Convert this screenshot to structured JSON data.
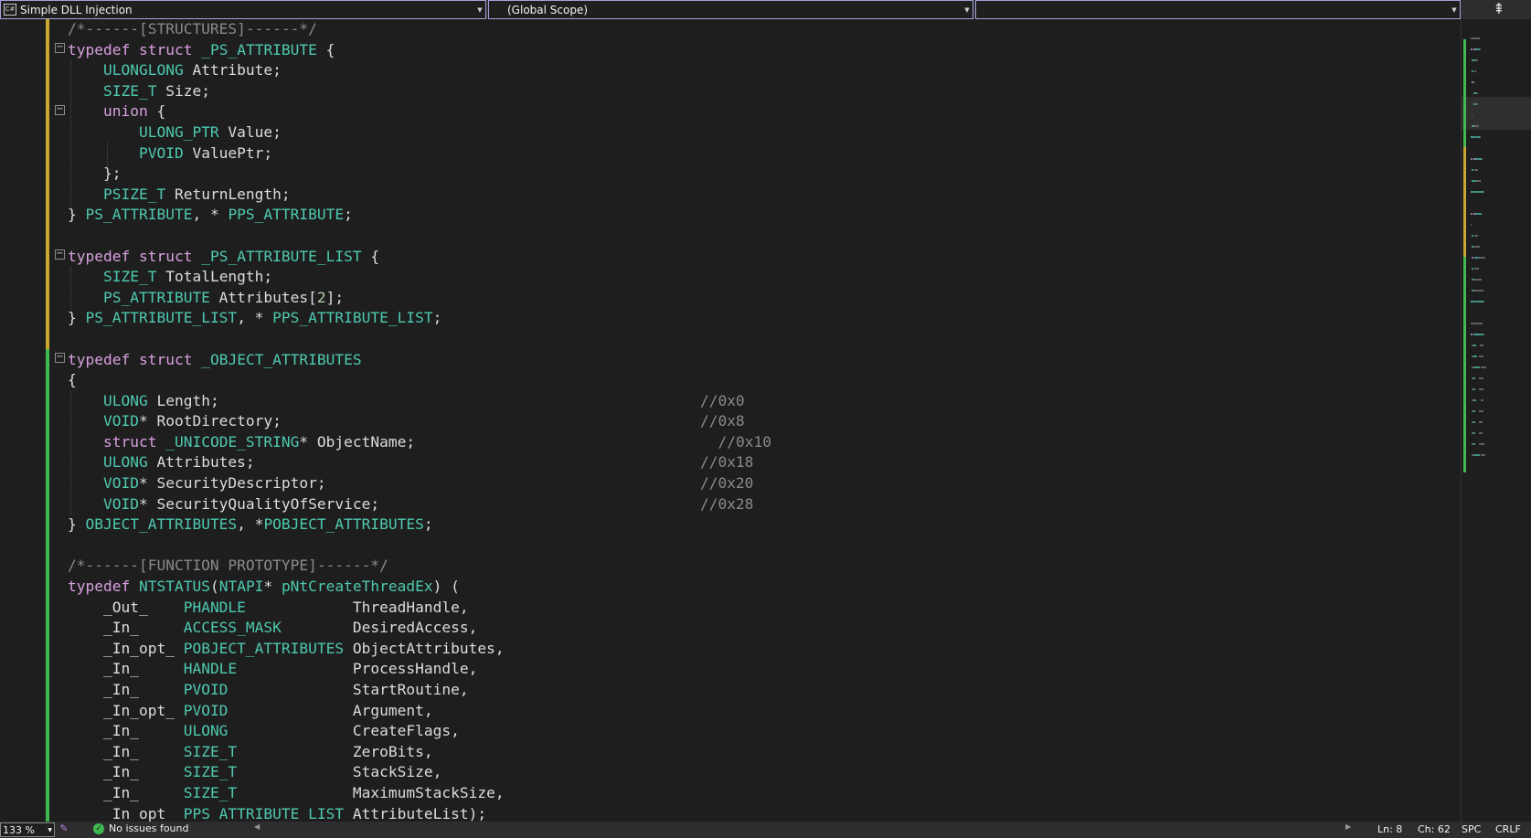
{
  "navbar": {
    "project": "Simple DLL Injection",
    "scope": "(Global Scope)",
    "member": "",
    "split_icon": "split-icon"
  },
  "code": {
    "lines": [
      [
        {
          "t": "/*------[STRUCTURES]------*/",
          "c": "cm2"
        }
      ],
      [
        {
          "t": "typedef",
          "c": "kw"
        },
        {
          "t": " ",
          "c": "pn"
        },
        {
          "t": "struct",
          "c": "kw"
        },
        {
          "t": " ",
          "c": "pn"
        },
        {
          "t": "_PS_ATTRIBUTE",
          "c": "ty"
        },
        {
          "t": " {",
          "c": "pn"
        }
      ],
      [
        {
          "t": "    ",
          "c": "pn"
        },
        {
          "t": "ULONGLONG",
          "c": "ty"
        },
        {
          "t": " Attribute;",
          "c": "id"
        }
      ],
      [
        {
          "t": "    ",
          "c": "pn"
        },
        {
          "t": "SIZE_T",
          "c": "ty"
        },
        {
          "t": " Size;",
          "c": "id"
        }
      ],
      [
        {
          "t": "    ",
          "c": "pn"
        },
        {
          "t": "union",
          "c": "kw"
        },
        {
          "t": " {",
          "c": "pn"
        }
      ],
      [
        {
          "t": "        ",
          "c": "pn"
        },
        {
          "t": "ULONG_PTR",
          "c": "ty"
        },
        {
          "t": " Value;",
          "c": "id"
        }
      ],
      [
        {
          "t": "        ",
          "c": "pn"
        },
        {
          "t": "PVOID",
          "c": "ty"
        },
        {
          "t": " ValuePtr;",
          "c": "id"
        }
      ],
      [
        {
          "t": "    };",
          "c": "pn"
        }
      ],
      [
        {
          "t": "    ",
          "c": "pn"
        },
        {
          "t": "PSIZE_T",
          "c": "ty"
        },
        {
          "t": " ReturnLength;",
          "c": "id"
        }
      ],
      [
        {
          "t": "} ",
          "c": "pn"
        },
        {
          "t": "PS_ATTRIBUTE",
          "c": "ty"
        },
        {
          "t": ", * ",
          "c": "pn"
        },
        {
          "t": "PPS_ATTRIBUTE",
          "c": "ty"
        },
        {
          "t": ";",
          "c": "pn"
        }
      ],
      [
        {
          "t": "",
          "c": "pn"
        }
      ],
      [
        {
          "t": "typedef",
          "c": "kw"
        },
        {
          "t": " ",
          "c": "pn"
        },
        {
          "t": "struct",
          "c": "kw"
        },
        {
          "t": " ",
          "c": "pn"
        },
        {
          "t": "_PS_ATTRIBUTE_LIST",
          "c": "ty"
        },
        {
          "t": " {",
          "c": "pn"
        }
      ],
      [
        {
          "t": "    ",
          "c": "pn"
        },
        {
          "t": "SIZE_T",
          "c": "ty"
        },
        {
          "t": " TotalLength;",
          "c": "id"
        }
      ],
      [
        {
          "t": "    ",
          "c": "pn"
        },
        {
          "t": "PS_ATTRIBUTE",
          "c": "ty"
        },
        {
          "t": " Attributes[",
          "c": "id"
        },
        {
          "t": "2",
          "c": "num"
        },
        {
          "t": "];",
          "c": "id"
        }
      ],
      [
        {
          "t": "} ",
          "c": "pn"
        },
        {
          "t": "PS_ATTRIBUTE_LIST",
          "c": "ty"
        },
        {
          "t": ", * ",
          "c": "pn"
        },
        {
          "t": "PPS_ATTRIBUTE_LIST",
          "c": "ty"
        },
        {
          "t": ";",
          "c": "pn"
        }
      ],
      [
        {
          "t": "",
          "c": "pn"
        }
      ],
      [
        {
          "t": "typedef",
          "c": "kw"
        },
        {
          "t": " ",
          "c": "pn"
        },
        {
          "t": "struct",
          "c": "kw"
        },
        {
          "t": " ",
          "c": "pn"
        },
        {
          "t": "_OBJECT_ATTRIBUTES",
          "c": "ty"
        }
      ],
      [
        {
          "t": "{",
          "c": "pn"
        }
      ],
      [
        {
          "t": "    ",
          "c": "pn"
        },
        {
          "t": "ULONG",
          "c": "ty"
        },
        {
          "t": " Length;                                                      ",
          "c": "id"
        },
        {
          "t": "//0x0",
          "c": "cm2"
        }
      ],
      [
        {
          "t": "    ",
          "c": "pn"
        },
        {
          "t": "VOID",
          "c": "ty"
        },
        {
          "t": "* RootDirectory;                                               ",
          "c": "id"
        },
        {
          "t": "//0x8",
          "c": "cm2"
        }
      ],
      [
        {
          "t": "    ",
          "c": "pn"
        },
        {
          "t": "struct",
          "c": "kw"
        },
        {
          "t": " ",
          "c": "pn"
        },
        {
          "t": "_UNICODE_STRING",
          "c": "ty"
        },
        {
          "t": "* ObjectName;                                  ",
          "c": "id"
        },
        {
          "t": "//0x10",
          "c": "cm2"
        }
      ],
      [
        {
          "t": "    ",
          "c": "pn"
        },
        {
          "t": "ULONG",
          "c": "ty"
        },
        {
          "t": " Attributes;                                                  ",
          "c": "id"
        },
        {
          "t": "//0x18",
          "c": "cm2"
        }
      ],
      [
        {
          "t": "    ",
          "c": "pn"
        },
        {
          "t": "VOID",
          "c": "ty"
        },
        {
          "t": "* SecurityDescriptor;                                          ",
          "c": "id"
        },
        {
          "t": "//0x20",
          "c": "cm2"
        }
      ],
      [
        {
          "t": "    ",
          "c": "pn"
        },
        {
          "t": "VOID",
          "c": "ty"
        },
        {
          "t": "* SecurityQualityOfService;                                    ",
          "c": "id"
        },
        {
          "t": "//0x28",
          "c": "cm2"
        }
      ],
      [
        {
          "t": "} ",
          "c": "pn"
        },
        {
          "t": "OBJECT_ATTRIBUTES",
          "c": "ty"
        },
        {
          "t": ", *",
          "c": "pn"
        },
        {
          "t": "POBJECT_ATTRIBUTES",
          "c": "ty"
        },
        {
          "t": ";",
          "c": "pn"
        }
      ],
      [
        {
          "t": "",
          "c": "pn"
        }
      ],
      [
        {
          "t": "/*------[FUNCTION PROTOTYPE]------*/",
          "c": "cm2"
        }
      ],
      [
        {
          "t": "typedef",
          "c": "kw"
        },
        {
          "t": " ",
          "c": "pn"
        },
        {
          "t": "NTSTATUS",
          "c": "ty"
        },
        {
          "t": "(",
          "c": "pn"
        },
        {
          "t": "NTAPI",
          "c": "ty"
        },
        {
          "t": "* ",
          "c": "pn"
        },
        {
          "t": "pNtCreateThreadEx",
          "c": "ty"
        },
        {
          "t": ") (",
          "c": "pn"
        }
      ],
      [
        {
          "t": "    _Out_    ",
          "c": "ann"
        },
        {
          "t": "PHANDLE",
          "c": "ty"
        },
        {
          "t": "            ThreadHandle,",
          "c": "id"
        }
      ],
      [
        {
          "t": "    _In_     ",
          "c": "ann"
        },
        {
          "t": "ACCESS_MASK",
          "c": "ty"
        },
        {
          "t": "        DesiredAccess,",
          "c": "id"
        }
      ],
      [
        {
          "t": "    _In_opt_ ",
          "c": "ann"
        },
        {
          "t": "POBJECT_ATTRIBUTES",
          "c": "ty"
        },
        {
          "t": " ObjectAttributes,",
          "c": "id"
        }
      ],
      [
        {
          "t": "    _In_     ",
          "c": "ann"
        },
        {
          "t": "HANDLE",
          "c": "ty"
        },
        {
          "t": "             ProcessHandle,",
          "c": "id"
        }
      ],
      [
        {
          "t": "    _In_     ",
          "c": "ann"
        },
        {
          "t": "PVOID",
          "c": "ty"
        },
        {
          "t": "              StartRoutine,",
          "c": "id"
        }
      ],
      [
        {
          "t": "    _In_opt_ ",
          "c": "ann"
        },
        {
          "t": "PVOID",
          "c": "ty"
        },
        {
          "t": "              Argument,",
          "c": "id"
        }
      ],
      [
        {
          "t": "    _In_     ",
          "c": "ann"
        },
        {
          "t": "ULONG",
          "c": "ty"
        },
        {
          "t": "              CreateFlags,",
          "c": "id"
        }
      ],
      [
        {
          "t": "    _In_     ",
          "c": "ann"
        },
        {
          "t": "SIZE_T",
          "c": "ty"
        },
        {
          "t": "             ZeroBits,",
          "c": "id"
        }
      ],
      [
        {
          "t": "    _In_     ",
          "c": "ann"
        },
        {
          "t": "SIZE_T",
          "c": "ty"
        },
        {
          "t": "             StackSize,",
          "c": "id"
        }
      ],
      [
        {
          "t": "    _In_     ",
          "c": "ann"
        },
        {
          "t": "SIZE_T",
          "c": "ty"
        },
        {
          "t": "             MaximumStackSize,",
          "c": "id"
        }
      ],
      [
        {
          "t": "    _In_opt_ ",
          "c": "ann"
        },
        {
          "t": "PPS_ATTRIBUTE_LIST",
          "c": "ty"
        },
        {
          "t": " AttributeList);",
          "c": "id"
        }
      ]
    ]
  },
  "statusbar": {
    "zoom": "133 %",
    "issues": "No issues found",
    "line": "Ln: 8",
    "char": "Ch: 62",
    "indent": "SPC",
    "eol": "CRLF"
  },
  "colors": {
    "keyword": "#d8a0df",
    "type": "#4ec9b0",
    "saved_change": "#3fb950",
    "unsaved_change": "#c8a630"
  }
}
